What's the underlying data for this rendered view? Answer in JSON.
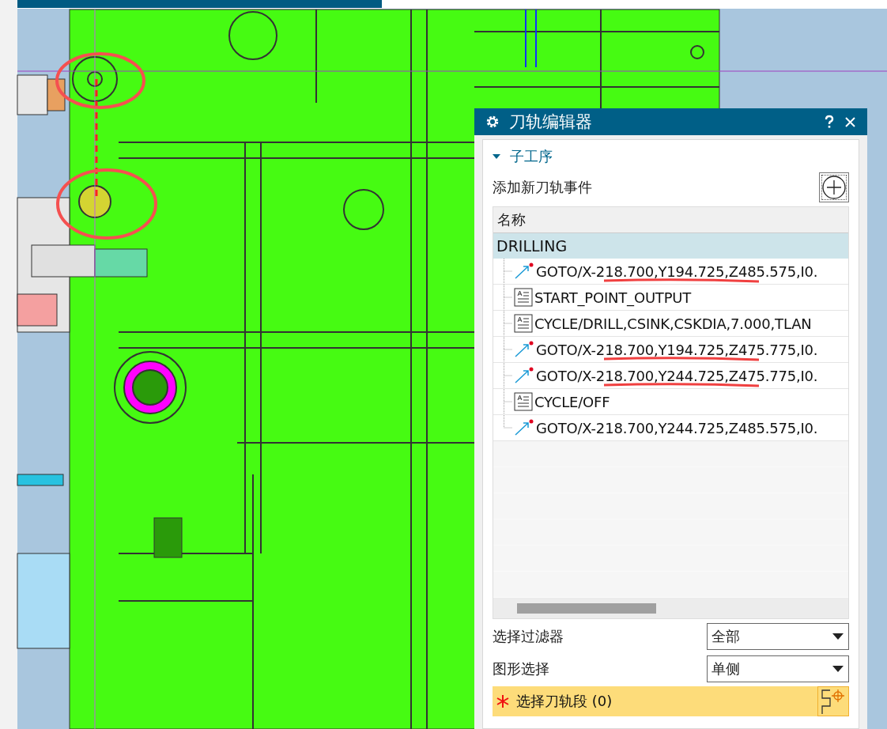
{
  "dialog": {
    "title": "刀轨编辑器",
    "section": {
      "title": "子工序",
      "expanded": true
    },
    "add_event_label": "添加新刀轨事件",
    "table": {
      "columns": [
        "名称"
      ],
      "parent": {
        "name": "DRILLING",
        "selected": true
      },
      "rows": [
        {
          "kind": "goto",
          "text": "GOTO/X-218.700,Y194.725,Z485.575,I0.",
          "underlined": true
        },
        {
          "kind": "text",
          "text": "START_POINT_OUTPUT",
          "underlined": false
        },
        {
          "kind": "text",
          "text": "CYCLE/DRILL,CSINK,CSKDIA,7.000,TLAN",
          "underlined": false
        },
        {
          "kind": "goto",
          "text": "GOTO/X-218.700,Y194.725,Z475.775,I0.",
          "underlined": true
        },
        {
          "kind": "goto",
          "text": "GOTO/X-218.700,Y244.725,Z475.775,I0.",
          "underlined": true
        },
        {
          "kind": "text",
          "text": "CYCLE/OFF",
          "underlined": false
        },
        {
          "kind": "goto",
          "text": "GOTO/X-218.700,Y244.725,Z485.575,I0.",
          "underlined": false
        }
      ]
    },
    "fields": [
      {
        "label": "选择过滤器",
        "value": "全部"
      },
      {
        "label": "图形选择",
        "value": "单侧"
      }
    ],
    "selection": {
      "label": "选择刀轨段 (0)",
      "required": true
    }
  }
}
